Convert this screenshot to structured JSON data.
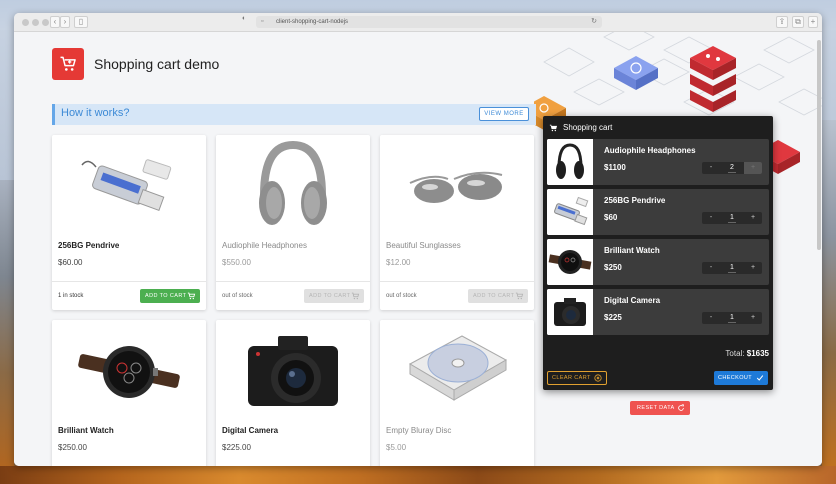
{
  "browser": {
    "url": "client-shopping-cart-nodejs"
  },
  "header": {
    "title": "Shopping cart demo"
  },
  "how": {
    "title": "How it works?",
    "view_more": "VIEW MORE"
  },
  "products": [
    {
      "name": "256BG Pendrive",
      "price": "$60.00",
      "stock": "1 in stock",
      "button": "ADD TO CART",
      "enabled": true
    },
    {
      "name": "Audiophile Headphones",
      "price": "$550.00",
      "stock": "out of stock",
      "button": "ADD TO CART",
      "enabled": false
    },
    {
      "name": "Beautiful Sunglasses",
      "price": "$12.00",
      "stock": "out of stock",
      "button": "ADD TO CART",
      "enabled": false
    },
    {
      "name": "Brilliant Watch",
      "price": "$250.00"
    },
    {
      "name": "Digital Camera",
      "price": "$225.00"
    },
    {
      "name": "Empty Bluray Disc",
      "price": "$5.00"
    }
  ],
  "cart": {
    "title": "Shopping cart",
    "items": [
      {
        "name": "Audiophile Headphones",
        "price": "$1100",
        "qty": "2",
        "minus": "-",
        "plus": "+"
      },
      {
        "name": "256BG Pendrive",
        "price": "$60",
        "qty": "1",
        "minus": "-",
        "plus": "+"
      },
      {
        "name": "Brilliant Watch",
        "price": "$250",
        "qty": "1",
        "minus": "-",
        "plus": "+"
      },
      {
        "name": "Digital Camera",
        "price": "$225",
        "qty": "1",
        "minus": "-",
        "plus": "+"
      }
    ],
    "total_label": "Total:",
    "total_value": "$1635",
    "clear": "CLEAR CART",
    "checkout": "CHECKOUT"
  },
  "reset": "RESET DATA",
  "colors": {
    "brand_red": "#e53935",
    "add_green": "#4caf50",
    "checkout_blue": "#1e7ad8",
    "clear_amber": "#e0a030",
    "reset_red": "#ef5350"
  }
}
